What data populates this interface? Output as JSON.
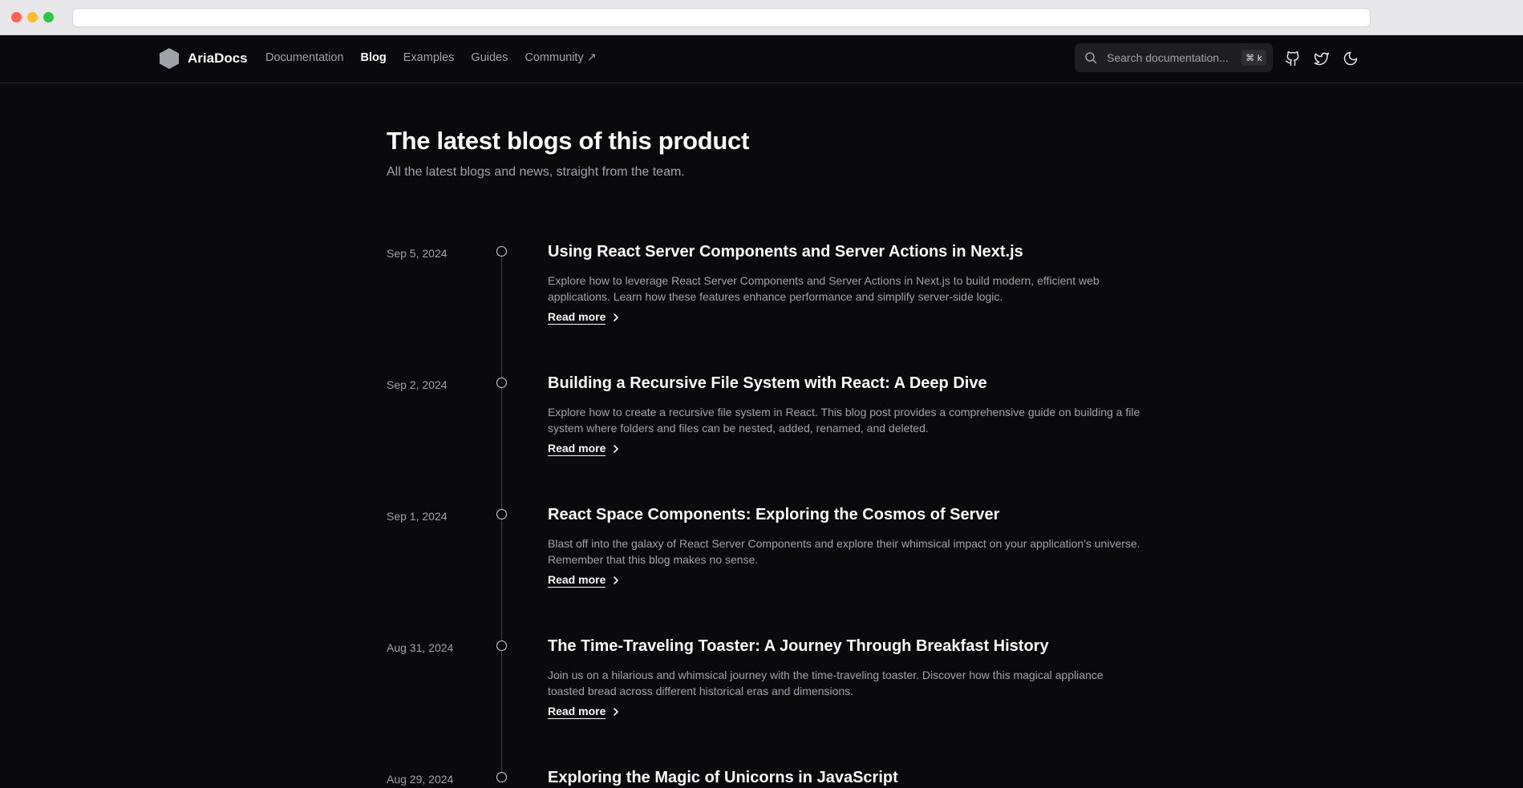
{
  "navbar": {
    "brand": "AriaDocs",
    "links": [
      {
        "label": "Documentation",
        "active": false
      },
      {
        "label": "Blog",
        "active": true
      },
      {
        "label": "Examples",
        "active": false
      },
      {
        "label": "Guides",
        "active": false
      },
      {
        "label": "Community ↗",
        "active": false
      }
    ],
    "search_placeholder": "Search documentation...",
    "search_shortcut": "⌘ k",
    "icons": [
      "github-icon",
      "twitter-icon",
      "moon-icon"
    ]
  },
  "page": {
    "title": "The latest blogs of this product",
    "subtitle": "All the latest blogs and news, straight from the team."
  },
  "posts": [
    {
      "date": "Sep 5, 2024",
      "title": "Using React Server Components and Server Actions in Next.js",
      "description": "Explore how to leverage React Server Components and Server Actions in Next.js to build modern, efficient web applications. Learn how these features enhance performance and simplify server-side logic.",
      "read_more": "Read more"
    },
    {
      "date": "Sep 2, 2024",
      "title": "Building a Recursive File System with React: A Deep Dive",
      "description": "Explore how to create a recursive file system in React. This blog post provides a comprehensive guide on building a file system where folders and files can be nested, added, renamed, and deleted.",
      "read_more": "Read more"
    },
    {
      "date": "Sep 1, 2024",
      "title": "React Space Components: Exploring the Cosmos of Server",
      "description": "Blast off into the galaxy of React Server Components and explore their whimsical impact on your application's universe. Remember that this blog makes no sense.",
      "read_more": "Read more"
    },
    {
      "date": "Aug 31, 2024",
      "title": "The Time-Traveling Toaster: A Journey Through Breakfast History",
      "description": "Join us on a hilarious and whimsical journey with the time-traveling toaster. Discover how this magical appliance toasted bread across different historical eras and dimensions.",
      "read_more": "Read more"
    },
    {
      "date": "Aug 29, 2024",
      "title": "Exploring the Magic of Unicorns in JavaScript",
      "description": "",
      "read_more": ""
    }
  ],
  "colors": {
    "background": "#0a0a0c",
    "text_primary": "#fafafa",
    "text_muted": "#a1a1aa",
    "border": "#27272a"
  }
}
